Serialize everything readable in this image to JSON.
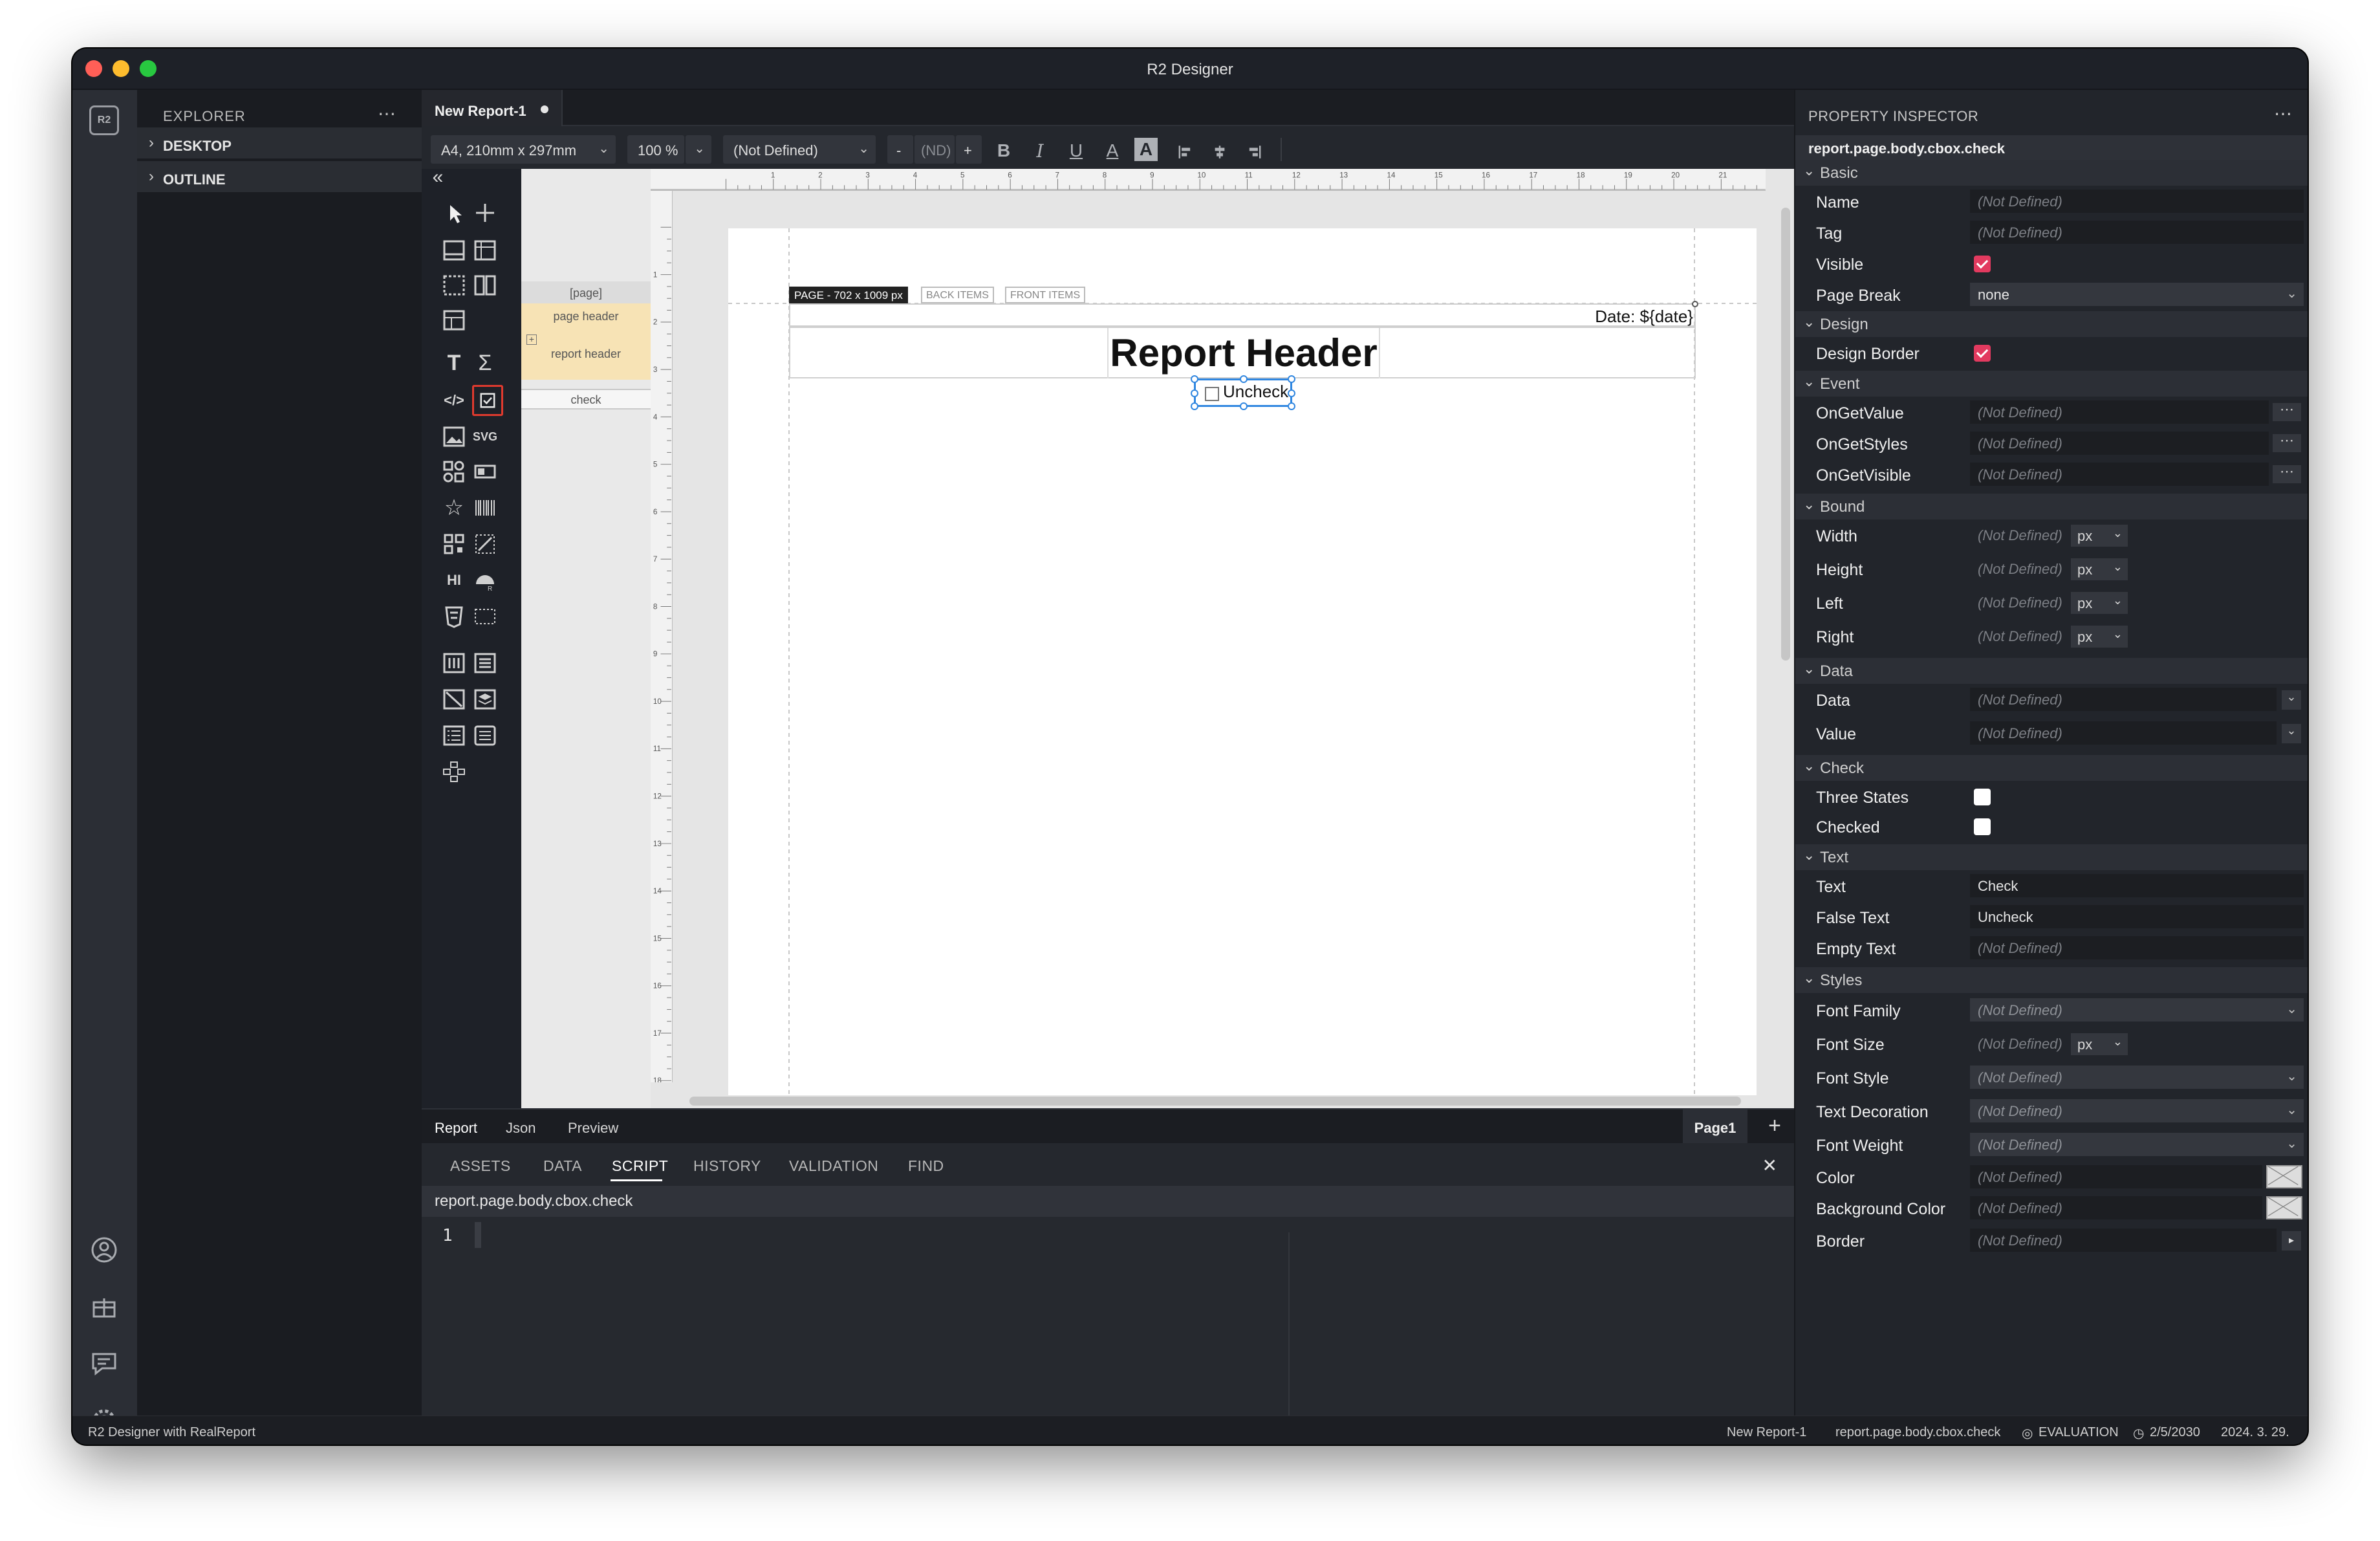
{
  "window": {
    "title": "R2 Designer"
  },
  "activity": {
    "logo": "R2"
  },
  "explorer": {
    "title": "EXPLORER",
    "more": "⋯",
    "items": [
      {
        "label": "DESKTOP"
      },
      {
        "label": "OUTLINE"
      }
    ]
  },
  "editor": {
    "tab": {
      "label": "New Report-1"
    },
    "toolbar": {
      "paper": "A4, 210mm x 297mm",
      "zoom": "100 %",
      "font": "(Not Defined)",
      "minus": "-",
      "size": "(ND)",
      "plus": "+",
      "bold": "B",
      "italic": "I",
      "underline": "U",
      "color": "A",
      "bg": "A"
    },
    "palette": {
      "collapse": "«",
      "svg": "SVG",
      "hi": "HI"
    },
    "bands": {
      "page": "[page]",
      "page_header": "page header",
      "report_header": "report header",
      "check": "check"
    },
    "canvas": {
      "page_tag": "PAGE - 702 x 1009 px",
      "back_items": "BACK ITEMS",
      "front_items": "FRONT ITEMS",
      "date_text": "Date: ${date}",
      "report_header": "Report Header",
      "check_text": "Uncheck"
    },
    "bottom_tabs": [
      "Report",
      "Json",
      "Preview"
    ],
    "page_tab": "Page1",
    "add_page": "+",
    "panel_tabs": [
      "ASSETS",
      "DATA",
      "SCRIPT",
      "HISTORY",
      "VALIDATION",
      "FIND"
    ],
    "panel_close": "✕",
    "path": "report.page.body.cbox.check",
    "line_number": "1"
  },
  "inspector": {
    "title": "PROPERTY INSPECTOR",
    "more": "⋯",
    "path": "report.page.body.cbox.check",
    "nd": "(Not Defined)",
    "px": "px",
    "sections": {
      "basic": "Basic",
      "design": "Design",
      "event": "Event",
      "bound": "Bound",
      "data": "Data",
      "check": "Check",
      "text": "Text",
      "styles": "Styles"
    },
    "props": {
      "name": "Name",
      "tag": "Tag",
      "visible": "Visible",
      "page_break": "Page Break",
      "design_border": "Design Border",
      "on_get_value": "OnGetValue",
      "on_get_styles": "OnGetStyles",
      "on_get_visible": "OnGetVisible",
      "width": "Width",
      "height": "Height",
      "left": "Left",
      "right": "Right",
      "data": "Data",
      "value": "Value",
      "three_states": "Three States",
      "checked": "Checked",
      "text": "Text",
      "false_text": "False Text",
      "empty_text": "Empty Text",
      "font_family": "Font Family",
      "font_size": "Font Size",
      "font_style": "Font Style",
      "text_decoration": "Text Decoration",
      "font_weight": "Font Weight",
      "color": "Color",
      "background_color": "Background Color",
      "border": "Border"
    },
    "values": {
      "page_break": "none",
      "text": "Check",
      "false_text": "Uncheck"
    }
  },
  "status": {
    "left": "R2 Designer with RealReport",
    "doc": "New Report-1",
    "path": "report.page.body.cbox.check",
    "eval": "EVALUATION",
    "expire": "2/5/2030",
    "date": "2024. 3. 29."
  }
}
